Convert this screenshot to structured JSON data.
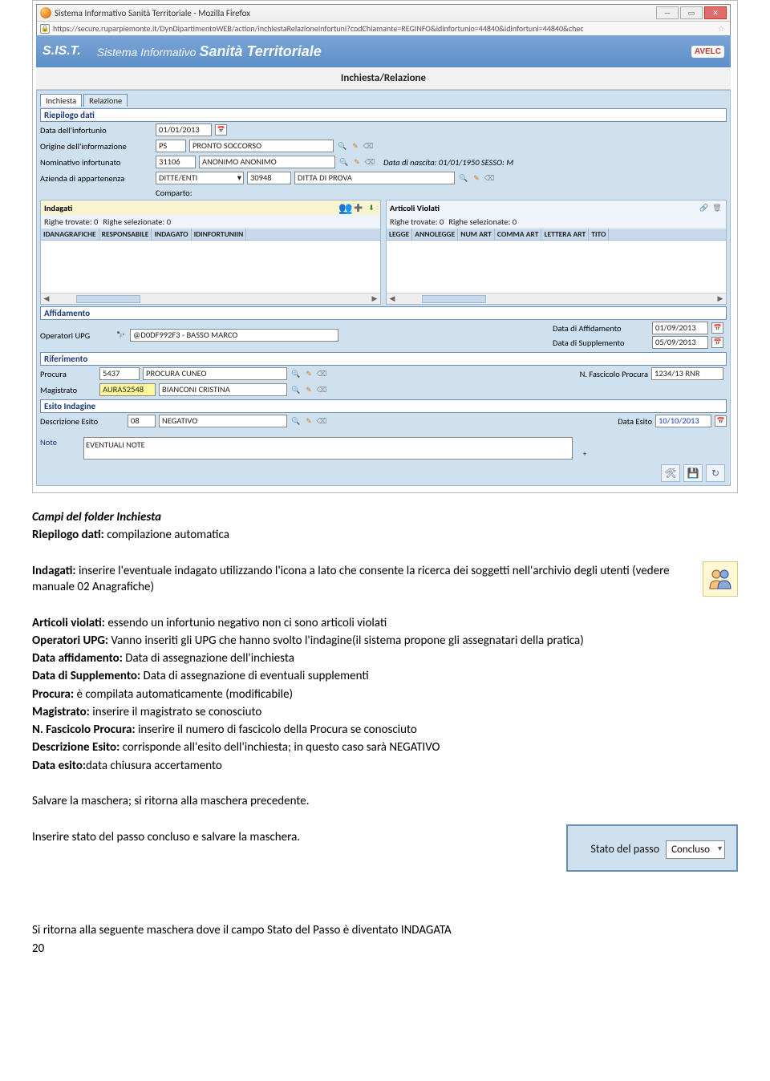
{
  "browser": {
    "title": "Sistema Informativo Sanità Territoriale - Mozilla Firefox",
    "url": "https://secure.ruparpiemonte.it/DynDipartimentoWEB/action/inchiestaRelazioneInfortuni?codChiamante=REGINFO&idinfortunio=44840&idinfortuni=44840&chec"
  },
  "header": {
    "logo": "S.IS.T.",
    "subtitle": "Sistema Informativo",
    "title": "Sanità Territoriale",
    "brand": "AVELC"
  },
  "page_title": "Inchiesta/Relazione",
  "tabs": [
    "Inchiesta",
    "Relazione"
  ],
  "sections": {
    "riepilogo": {
      "title": "Riepilogo dati",
      "data_infortunio_lbl": "Data dell'infortunio",
      "data_infortunio_val": "01/01/2013",
      "origine_lbl": "Origine dell'informazione",
      "origine_code": "PS",
      "origine_desc": "PRONTO SOCCORSO",
      "nominativo_lbl": "Nominativo infortunato",
      "nominativo_code": "31106",
      "nominativo_desc": "ANONIMO ANONIMO",
      "nascita_lbl": "Data di nascita: 01/01/1950    SESSO: M",
      "azienda_lbl": "Azienda di appartenenza",
      "azienda_sel": "DITTE/ENTI",
      "azienda_code": "30948",
      "azienda_desc": "DITTA DI PROVA",
      "comparto_lbl": "Comparto:"
    },
    "indagati": {
      "title": "Indagati",
      "rows_found": "Righe trovate: 0",
      "rows_sel": "Righe selezionate: 0",
      "cols": [
        "IDANAGRAFICHE",
        "RESPONSABILE",
        "INDAGATO",
        "IDINFORTUNIIN"
      ]
    },
    "articoli": {
      "title": "Articoli Violati",
      "rows_found": "Righe trovate: 0",
      "rows_sel": "Righe selezionate: 0",
      "cols": [
        "LEGGE",
        "ANNOLEGGE",
        "NUM ART",
        "COMMA ART",
        "LETTERA ART",
        "TITO"
      ]
    },
    "affidamento": {
      "title": "Affidamento",
      "op_lbl": "Operatori UPG",
      "op_val": "@D0DF992F3 - BASSO MARCO",
      "data_aff_lbl": "Data di Affidamento",
      "data_aff_val": "01/09/2013",
      "data_sup_lbl": "Data di Supplemento",
      "data_sup_val": "05/09/2013"
    },
    "riferimento": {
      "title": "Riferimento",
      "procura_lbl": "Procura",
      "procura_code": "5437",
      "procura_desc": "PROCURA CUNEO",
      "fascicolo_lbl": "N. Fascicolo Procura",
      "fascicolo_val": "1234/13 RNR",
      "magistrato_lbl": "Magistrato",
      "magistrato_code": "AURA52548",
      "magistrato_desc": "BIANCONI CRISTINA"
    },
    "esito": {
      "title": "Esito Indagine",
      "desc_lbl": "Descrizione Esito",
      "desc_code": "08",
      "desc_val": "NEGATIVO",
      "data_lbl": "Data Esito",
      "data_val": "10/10/2013"
    },
    "note_lbl": "Note",
    "note_val": "EVENTUALI NOTE"
  },
  "doc": {
    "heading": "Campi del folder Inchiesta",
    "line1a": "Riepilogo dati:",
    "line1b": " compilazione automatica",
    "line2a": "Indagati:",
    "line2b": " inserire l'eventuale indagato utilizzando l'icona a lato che consente la ricerca dei soggetti nell'archivio degli utenti (vedere manuale 02 Anagrafiche)",
    "line3a": "Articoli violati:",
    "line3b": " essendo un infortunio negativo non ci sono articoli violati",
    "line4a": "Operatori UPG:",
    "line4b": " Vanno inseriti gli UPG che hanno svolto l'indagine(il sistema propone gli assegnatari della pratica)",
    "line5a": "Data affidamento:",
    "line5b": " Data di assegnazione dell'inchiesta",
    "line6a": "Data di Supplemento:",
    "line6b": " Data di assegnazione di eventuali supplementi",
    "line7a": "Procura:",
    "line7b": " è compilata automaticamente (modificabile)",
    "line8a": "Magistrato:",
    "line8b": " inserire il magistrato se conosciuto",
    "line9a": "N. Fascicolo Procura:",
    "line9b": " inserire il numero di fascicolo della Procura se conosciuto",
    "line10a": "Descrizione Esito:",
    "line10b": " corrisponde all'esito dell'inchiesta; in questo caso sarà NEGATIVO",
    "line11a": "Data esito:",
    "line11b": "data chiusura accertamento",
    "para2": "Salvare la maschera; si ritorna alla maschera precedente.",
    "para3": "Inserire stato del passo concluso e salvare la maschera.",
    "stato_lbl": "Stato del passo",
    "stato_val": "Concluso",
    "para4": "Si ritorna alla seguente maschera dove il campo Stato del Passo è diventato INDAGATA"
  },
  "page_number": "20"
}
